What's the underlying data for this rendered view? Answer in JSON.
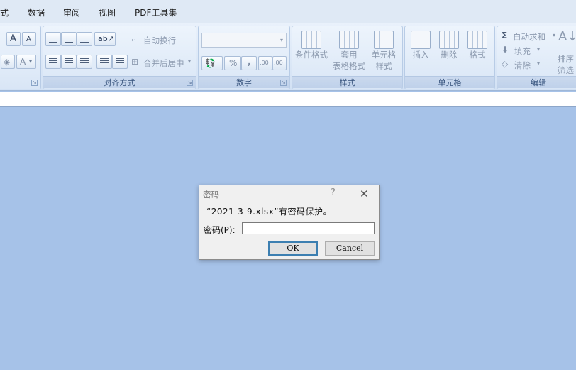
{
  "menu": [
    "式",
    "数据",
    "审阅",
    "视图",
    "PDF工具集"
  ],
  "ribbon": {
    "font": {
      "grow_label": "A",
      "shrink_label": "A",
      "font_color_label": "A"
    },
    "alignment": {
      "wrap_text": "自动换行",
      "merge_center": "合并后居中",
      "label": "对齐方式"
    },
    "number": {
      "percent": "%",
      "comma": ",",
      "inc_decimal": ".00",
      "dec_decimal": ".00",
      "label": "数字"
    },
    "styles": {
      "conditional": "条件格式",
      "table_line1": "套用",
      "table_line2": "表格格式",
      "cell_line1": "单元格",
      "cell_line2": "样式",
      "label": "样式"
    },
    "cells": {
      "insert": "插入",
      "delete": "删除",
      "format": "格式",
      "label": "单元格"
    },
    "editing": {
      "sum_symbol": "Σ",
      "autosum": "自动求和",
      "fill": "填充",
      "clear": "清除",
      "sort_line1": "排序",
      "sort_line2": "筛选",
      "label": "编辑"
    }
  },
  "dialog": {
    "title": "密码",
    "help": "?",
    "close": "✕",
    "message": "“2021-3-9.xlsx”有密码保护。",
    "password_label": "密码(P):",
    "password_value": "",
    "ok": "OK",
    "cancel": "Cancel"
  }
}
